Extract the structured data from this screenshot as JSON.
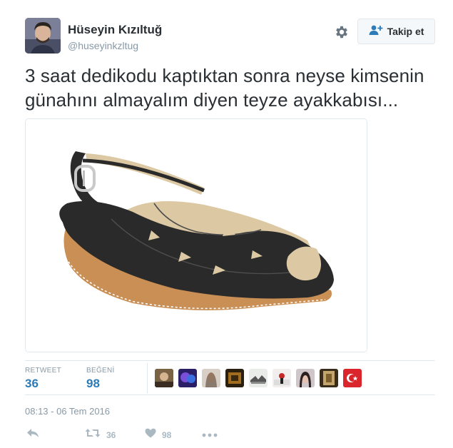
{
  "user": {
    "name": "Hüseyin Kızıltuğ",
    "handle": "@huseyinkzltug"
  },
  "follow": {
    "label": "Takip et"
  },
  "tweet": {
    "text": "3 saat dedikodu kaptıktan sonra neyse kimsenin günahını almayalım diyen teyze ayakkabısı..."
  },
  "stats": {
    "retweet_label": "RETWEET",
    "retweet_count": "36",
    "like_label": "BEĞENİ",
    "like_count": "98"
  },
  "likers_count": 9,
  "timestamp": "08:13 - 06 Tem 2016",
  "actions": {
    "retweet_count": "36",
    "like_count": "98"
  },
  "colors": {
    "accent": "#2b7bb9",
    "muted": "#8899a6",
    "border": "#e1e8ed"
  }
}
